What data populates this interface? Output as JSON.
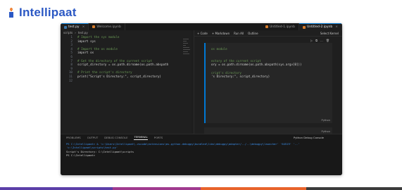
{
  "brand": {
    "name": "ntellipaat",
    "lead": "I"
  },
  "tabs": [
    {
      "label": "test.py",
      "active": true
    },
    {
      "label": "Welcome.ipynb",
      "active": false
    },
    {
      "label": "Untitled-1.ipynb",
      "active": false
    },
    {
      "label": "Untitled-2.ipynb",
      "active": false
    }
  ],
  "breadcrumb": {
    "folder": "scripts",
    "file": "test.py"
  },
  "code_lines": [
    {
      "n": "1",
      "text": "# Import the sys module",
      "kind": "com"
    },
    {
      "n": "2",
      "text": "import sys",
      "kind": "code"
    },
    {
      "n": "3",
      "text": "",
      "kind": "code"
    },
    {
      "n": "4",
      "text": "# Import the os module",
      "kind": "com"
    },
    {
      "n": "5",
      "text": "import os",
      "kind": "code"
    },
    {
      "n": "6",
      "text": "",
      "kind": "code"
    },
    {
      "n": "7",
      "text": "# Get the directory of the current script",
      "kind": "com"
    },
    {
      "n": "8",
      "text": "script_directory = os.path.dirname(os.path.abspath",
      "kind": "code"
    },
    {
      "n": "9",
      "text": "",
      "kind": "code"
    },
    {
      "n": "10",
      "text": "# Print the script's directory",
      "kind": "com"
    },
    {
      "n": "11",
      "text": "print(\"Script's Directory:\", script_directory)",
      "kind": "code"
    },
    {
      "n": "12",
      "text": "",
      "kind": "code"
    }
  ],
  "notebook": {
    "toolbar": [
      "+ Code",
      "+ Markdown",
      "Run All",
      "Outline"
    ],
    "kernel": "Select Kernel",
    "cell_lines": [
      "os module",
      "",
      "",
      "ectory of the current script",
      "ory = os.path.dirname(os.path.abspath(sys.argv[0]))",
      "",
      "cript's directory",
      "'s Directory:\", script_directory)"
    ],
    "cell_lang": "Python",
    "cell2_lang": "Python"
  },
  "panel": {
    "tabs": [
      "PROBLEMS",
      "OUTPUT",
      "DEBUG CONSOLE",
      "TERMINAL",
      "PORTS"
    ],
    "active_tab": "TERMINAL",
    "terminal_name": "Python Debug Console",
    "lines": [
      "PS C:\\Intellipaat>  & 'c:\\Users\\Intellipaat\\.vscode\\extensions\\ms-python.debugpy\\bundled\\libs\\debugpy\\adapter/../..\\debugpy\\launcher' '64519' '--' 'c:\\Intellipaat\\scripts\\test.py'",
      "Script's Directory: C:\\Intellipaat\\scripts",
      "PS C:\\Intellipaat>"
    ]
  }
}
